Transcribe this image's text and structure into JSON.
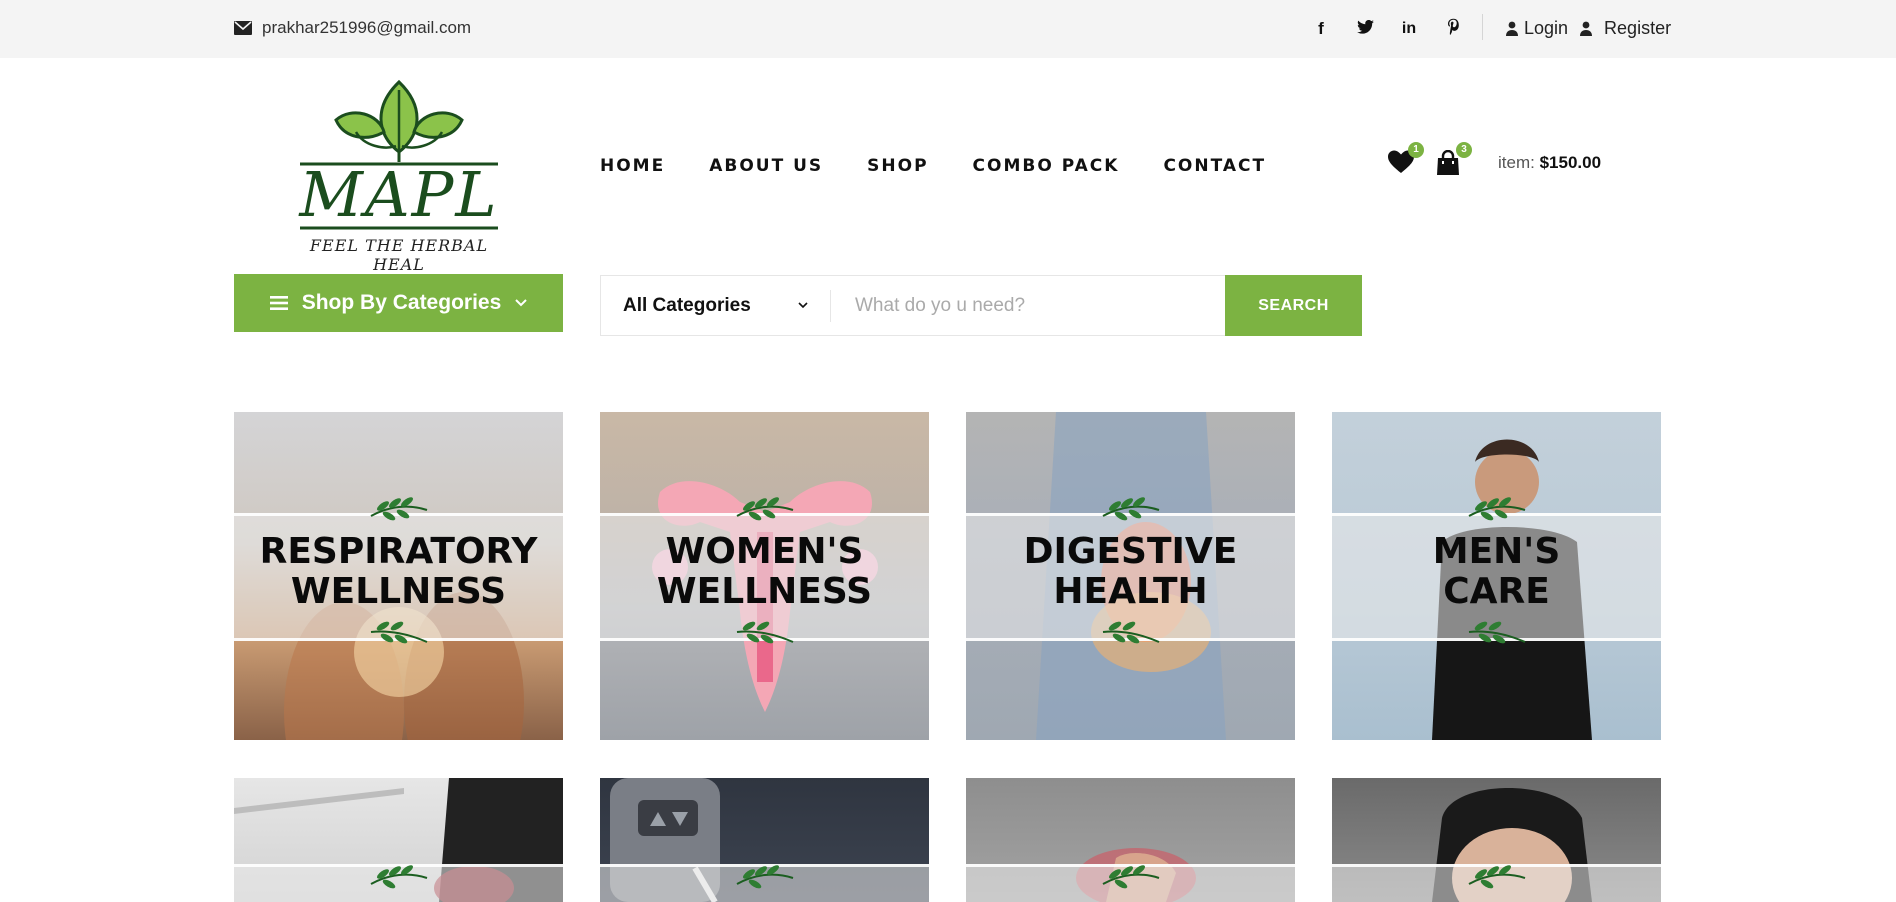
{
  "topbar": {
    "email": "prakhar251996@gmail.com",
    "social_icons": [
      "facebook-icon",
      "twitter-icon",
      "linkedin-icon",
      "pinterest-icon"
    ],
    "login_label": "Login",
    "register_label": "Register"
  },
  "logo": {
    "name": "MAPL",
    "tagline": "FEEL THE HERBAL HEAL"
  },
  "nav": [
    "HOME",
    "ABOUT US",
    "SHOP",
    "COMBO PACK",
    "CONTACT"
  ],
  "cart": {
    "wishlist_count": "1",
    "cart_count": "3",
    "item_prefix": "item:",
    "item_total": "$150.00"
  },
  "categories_button": "Shop By Categories",
  "search": {
    "category": "All Categories",
    "placeholder": "What do yo u need?",
    "button": "SEARCH"
  },
  "cards": [
    {
      "line1": "RESPIRATORY",
      "line2": "WELLNESS"
    },
    {
      "line1": "WOMEN'S",
      "line2": "WELLNESS"
    },
    {
      "line1": "DIGESTIVE",
      "line2": "HEALTH"
    },
    {
      "line1": "MEN'S",
      "line2": "CARE"
    }
  ],
  "colors": {
    "accent": "#7cb342",
    "topbar_bg": "#f4f4f4",
    "leaf": "#1b5e20"
  }
}
